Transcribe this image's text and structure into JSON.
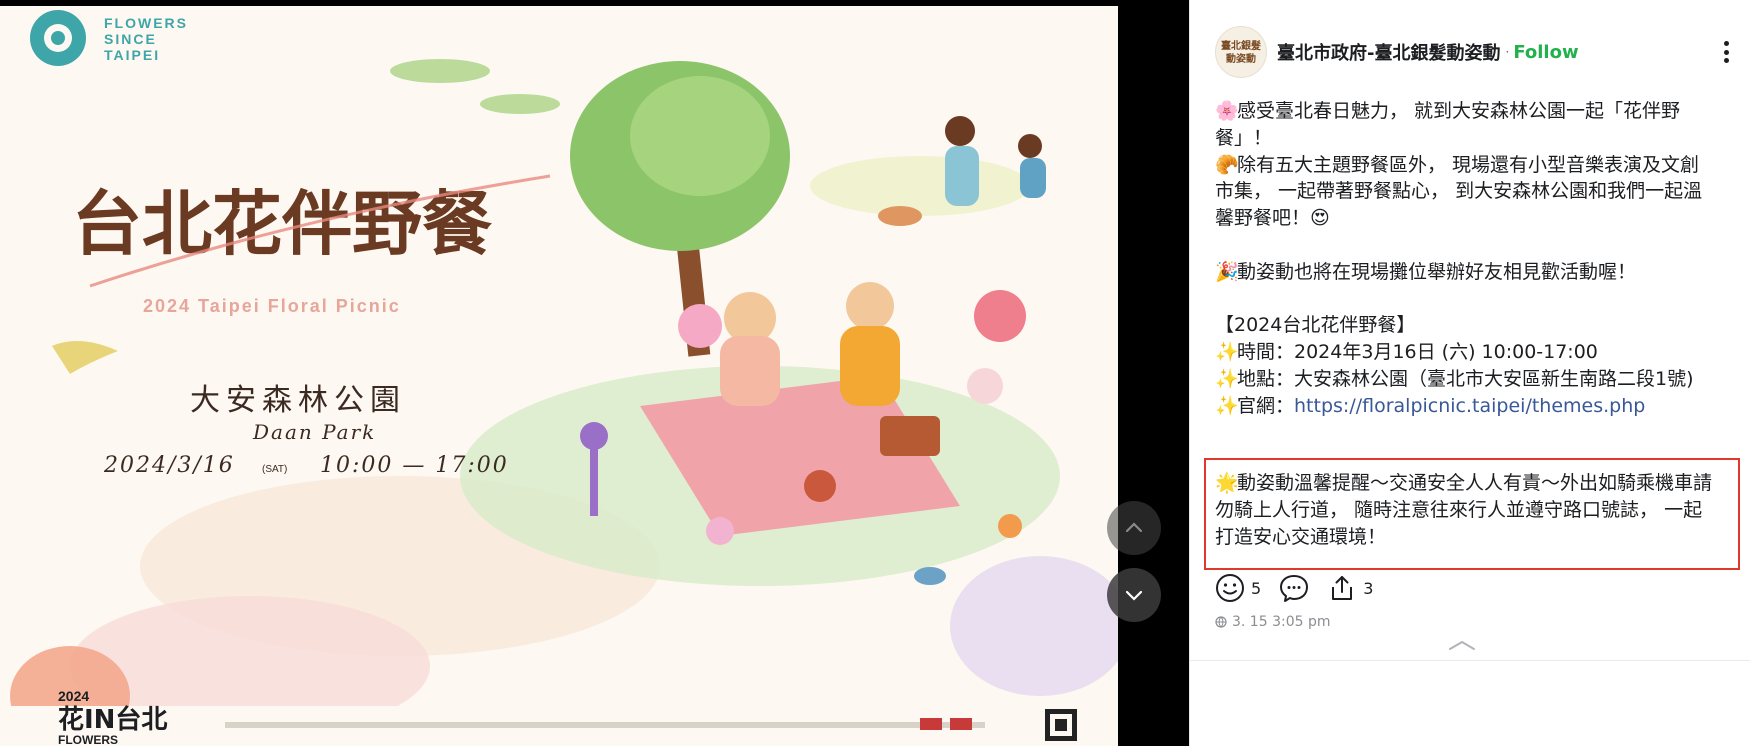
{
  "poster": {
    "logo_lines": [
      "FLOWERS",
      "SINCE",
      "TAIPEI"
    ],
    "title_cn": "台北花伴野餐",
    "title_en": "2024 Taipei Floral Picnic",
    "venue_cn": "大安森林公園",
    "venue_en": "Daan Park",
    "date": "2024/3/16",
    "weekday": "(SAT)",
    "time": "10:00 — 17:00",
    "badge_year": "2024",
    "badge_main": "花IN台北",
    "badge_sub": "FLOWERS"
  },
  "viewer": {
    "prev_icon": "chevron-up-icon",
    "next_icon": "chevron-down-icon"
  },
  "post": {
    "page_name": "臺北市政府-臺北銀髮動姿動",
    "separator": "·",
    "follow_label": "Follow",
    "avatar_text": [
      "臺北銀髮",
      "動姿動"
    ],
    "body": {
      "line1_emoji": "🌸",
      "line1": "感受臺北春日魅力，  就到大安森林公園一起「花伴野餐」！",
      "line2_emoji": "🥐",
      "line2": "除有五大主題野餐區外，  現場還有小型音樂表演及文創市集，  一起帶著野餐點心，  到大安森林公園和我們一起溫馨野餐吧！😍",
      "line3_emoji": "🎉",
      "line3": "動姿動也將在現場攤位舉辦好友相見歡活動喔！",
      "event_title": "【2024台北花伴野餐】",
      "time_emoji": "✨",
      "time_line": "時間：2024年3月16日 (六) 10:00-17:00",
      "place_emoji": "✨",
      "place_line": "地點：大安森林公園（臺北市大安區新生南路二段1號)",
      "site_emoji": "✨",
      "site_label": "官網：",
      "site_url": "https://floralpicnic.taipei/themes.php"
    },
    "reminder_emoji": "🌟",
    "reminder": "動姿動溫馨提醒～交通安全人人有責～外出如騎乘機車請勿騎上人行道，  隨時注意往來行人並遵守路口號誌，  一起打造安心交通環境！",
    "reactions": {
      "icon": "smiley-icon",
      "count": "5"
    },
    "comments": {
      "icon": "comment-icon"
    },
    "shares": {
      "icon": "share-icon",
      "count": "3"
    },
    "timestamp": "3. 15 3:05 pm"
  },
  "colors": {
    "follow": "#22b14c",
    "link": "#385898",
    "highlight": "#e0382c"
  }
}
